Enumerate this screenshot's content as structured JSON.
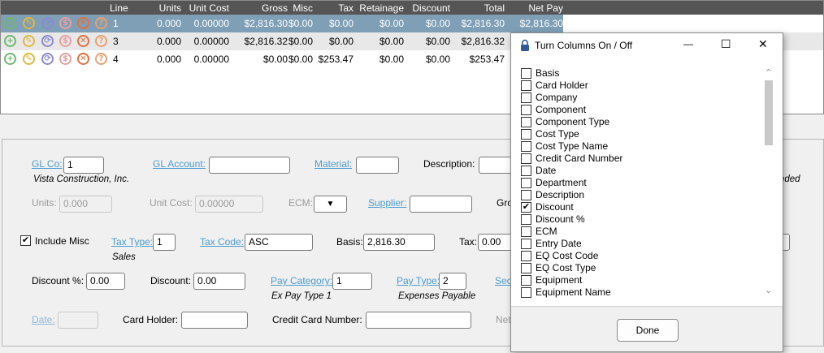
{
  "grid": {
    "headers": [
      "Line",
      "Units",
      "Unit Cost",
      "Gross",
      "Misc",
      "Tax",
      "Retainage",
      "Discount",
      "Total",
      "Net Pay"
    ],
    "rows": [
      {
        "line": "1",
        "units": "0.000",
        "unit_cost": "0.00000",
        "gross": "$2,816.30",
        "misc": "$0.00",
        "tax": "$0.00",
        "retainage": "$0.00",
        "discount": "$0.00",
        "total": "$2,816.30",
        "net_pay": "$2,816.30"
      },
      {
        "line": "3",
        "units": "0.000",
        "unit_cost": "0.00000",
        "gross": "$2,816.32",
        "misc": "$0.00",
        "tax": "$0.00",
        "retainage": "$0.00",
        "discount": "$0.00",
        "total": "$2,816.32",
        "net_pay": ""
      },
      {
        "line": "4",
        "units": "0.000",
        "unit_cost": "0.00000",
        "gross": "$0.00",
        "misc": "$0.00",
        "tax": "$253.47",
        "retainage": "$0.00",
        "discount": "$0.00",
        "total": "$253.47",
        "net_pay": ""
      }
    ],
    "row_icons": [
      "add-icon",
      "edit-icon",
      "refresh-icon",
      "dollar-icon",
      "delete-icon",
      "help-icon"
    ],
    "icon_glyphs": {
      "add": "+",
      "edit": "✎",
      "refresh": "⟳",
      "dollar": "$",
      "delete": "✕",
      "help": "?"
    }
  },
  "form": {
    "gl_co_label": "GL Co:",
    "gl_co_value": "1",
    "gl_co_name": "Vista Construction, Inc.",
    "gl_account_label": "GL Account:",
    "gl_account_value": "",
    "material_label": "Material:",
    "material_value": "",
    "description_label": "Description:",
    "description_value": "",
    "partial_right_text": "nded",
    "units_label": "Units:",
    "units_value": "0.000",
    "unit_cost_label": "Unit Cost:",
    "unit_cost_value": "0.00000",
    "ecm_label": "ECM:",
    "ecm_arrow": "▼",
    "supplier_label": "Supplier:",
    "supplier_value": "",
    "gross_partial_label": "Gro",
    "include_misc_label": "Include Misc",
    "include_misc_checked": "✔",
    "tax_type_label": "Tax Type:",
    "tax_type_value": "1",
    "tax_type_desc": "Sales",
    "tax_code_label": "Tax Code:",
    "tax_code_value": "ASC",
    "basis_label": "Basis:",
    "basis_value": "2,816.30",
    "tax_label": "Tax:",
    "tax_value": "0.00",
    "discount_pct_label": "Discount %:",
    "discount_pct_value": "0.00",
    "discount_label": "Discount:",
    "discount_value": "0.00",
    "pay_category_label": "Pay Category:",
    "pay_category_value": "1",
    "pay_category_desc": "Ex Pay Type 1",
    "pay_type_label": "Pay Type:",
    "pay_type_value": "2",
    "pay_type_desc": "Expenses Payable",
    "sec_partial_label": "Sec",
    "date_label": "Date:",
    "date_value": "",
    "card_holder_label": "Card Holder:",
    "card_holder_value": "",
    "ccn_label": "Credit Card Number:",
    "ccn_value": "",
    "net_partial_label": "Net"
  },
  "dialog": {
    "title": "Turn Columns On / Off",
    "minimize": "—",
    "maximize": "☐",
    "close": "✕",
    "items": [
      {
        "label": "Basis",
        "checked": ""
      },
      {
        "label": "Card Holder",
        "checked": ""
      },
      {
        "label": "Company",
        "checked": ""
      },
      {
        "label": "Component",
        "checked": ""
      },
      {
        "label": "Component Type",
        "checked": ""
      },
      {
        "label": "Cost Type",
        "checked": ""
      },
      {
        "label": "Cost Type Name",
        "checked": ""
      },
      {
        "label": "Credit Card Number",
        "checked": ""
      },
      {
        "label": "Date",
        "checked": ""
      },
      {
        "label": "Department",
        "checked": ""
      },
      {
        "label": "Description",
        "checked": ""
      },
      {
        "label": "Discount",
        "checked": "✔"
      },
      {
        "label": "Discount %",
        "checked": ""
      },
      {
        "label": "ECM",
        "checked": ""
      },
      {
        "label": "Entry Date",
        "checked": ""
      },
      {
        "label": "EQ Cost Code",
        "checked": ""
      },
      {
        "label": "EQ Cost Type",
        "checked": ""
      },
      {
        "label": "Equipment",
        "checked": ""
      },
      {
        "label": "Equipment Name",
        "checked": ""
      }
    ],
    "scroll_up": "⌃",
    "scroll_down": "⌄",
    "done_label": "Done"
  }
}
